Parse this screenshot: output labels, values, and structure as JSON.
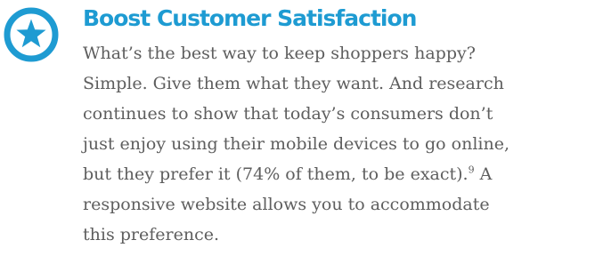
{
  "icon": "star-circle-icon",
  "colors": {
    "accent": "#1e9bd2",
    "body_text": "#5e5e5e"
  },
  "heading": "Boost Customer Satisfaction",
  "paragraph": {
    "line1": "What’s the best way to keep shoppers happy?",
    "line2": "Simple. Give them what they want. And research",
    "line3": "continues to show that today’s consumers don’t",
    "line4": "just enjoy using their mobile devices to go online,",
    "line5_before": "but they prefer it (74% of them, to be exact).",
    "footnote": "9",
    "line5_after": " A",
    "line6": "responsive website allows you to accommodate",
    "line7": "this preference."
  }
}
